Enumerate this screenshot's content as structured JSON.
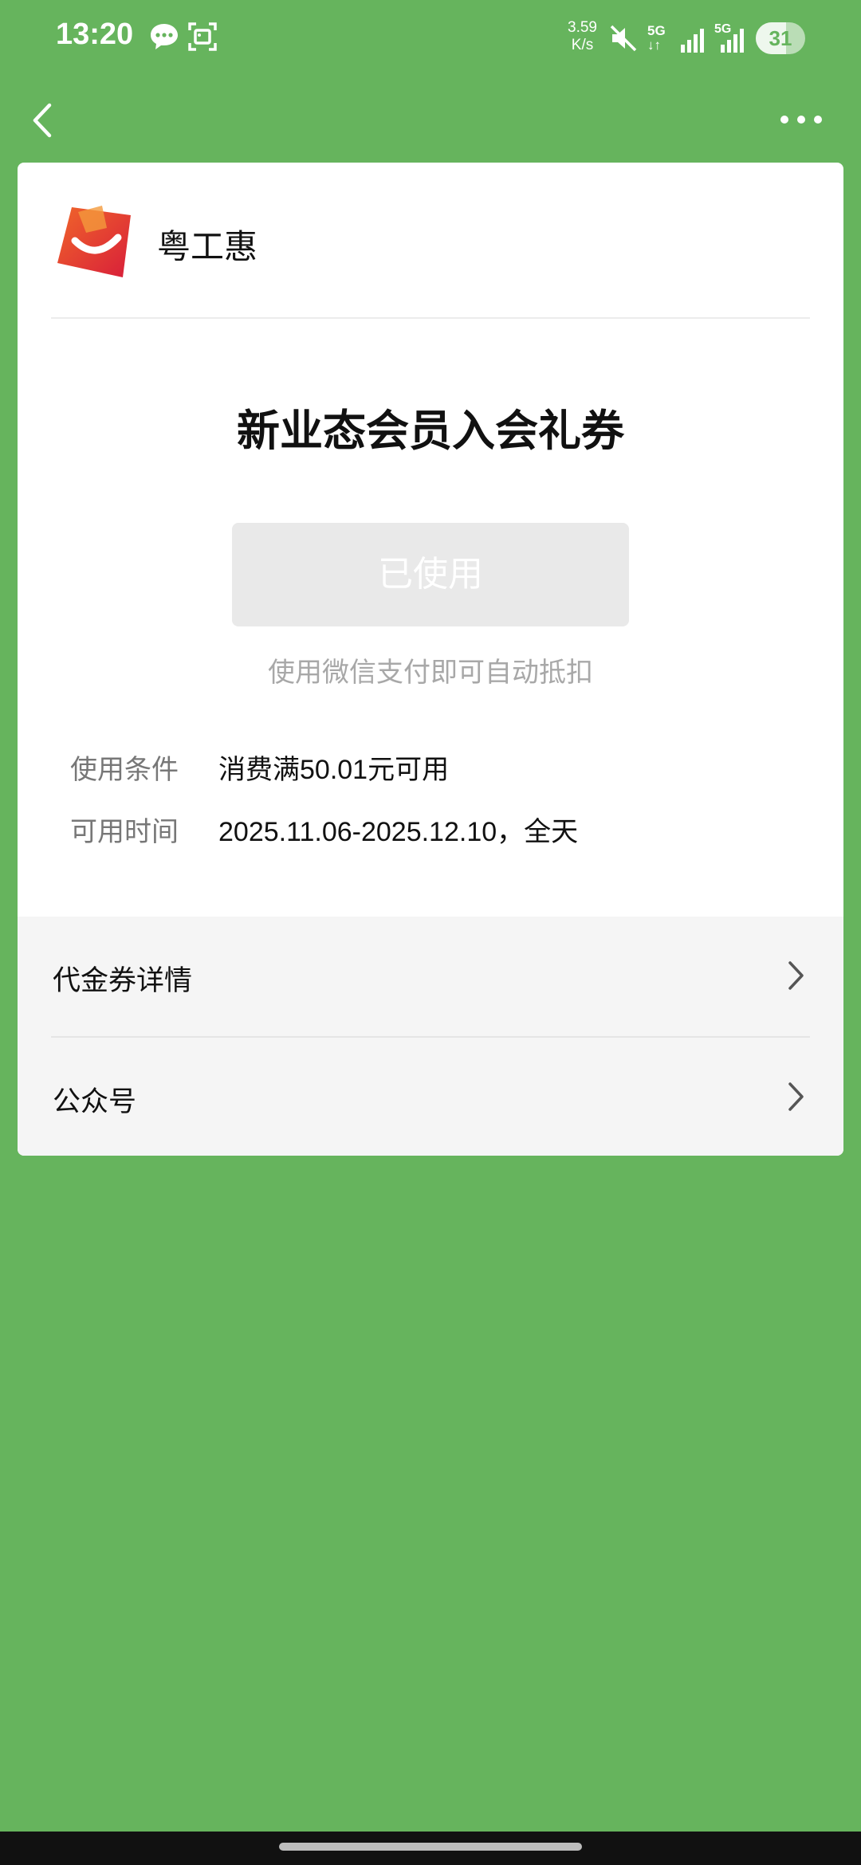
{
  "status_bar": {
    "time": "13:20",
    "net_speed_value": "3.59",
    "net_speed_unit": "K/s",
    "network_1": "5G",
    "network_2": "5G",
    "battery": "31",
    "icons": [
      "message-icon",
      "scan-icon",
      "mute-icon",
      "signal-icon",
      "signal-icon",
      "battery-icon"
    ]
  },
  "nav": {
    "back_icon": "back-arrow-icon",
    "more_icon": "more-dots-icon"
  },
  "merchant": {
    "name": "粤工惠",
    "logo_icon": "merchant-logo"
  },
  "coupon": {
    "title": "新业态会员入会礼券",
    "status_button": "已使用",
    "pay_hint": "使用微信支付即可自动抵扣",
    "condition_label": "使用条件",
    "condition_value": "消费满50.01元可用",
    "time_label": "可用时间",
    "time_value": "2025.11.06-2025.12.10，全天"
  },
  "menu": {
    "items": [
      {
        "label": "代金券详情",
        "icon": "chevron-right-icon"
      },
      {
        "label": "公众号",
        "icon": "chevron-right-icon"
      }
    ]
  },
  "colors": {
    "background": "#66b45d",
    "card": "#ffffff",
    "menu_bg": "#f5f5f5",
    "logo_red": "#e8342c"
  }
}
